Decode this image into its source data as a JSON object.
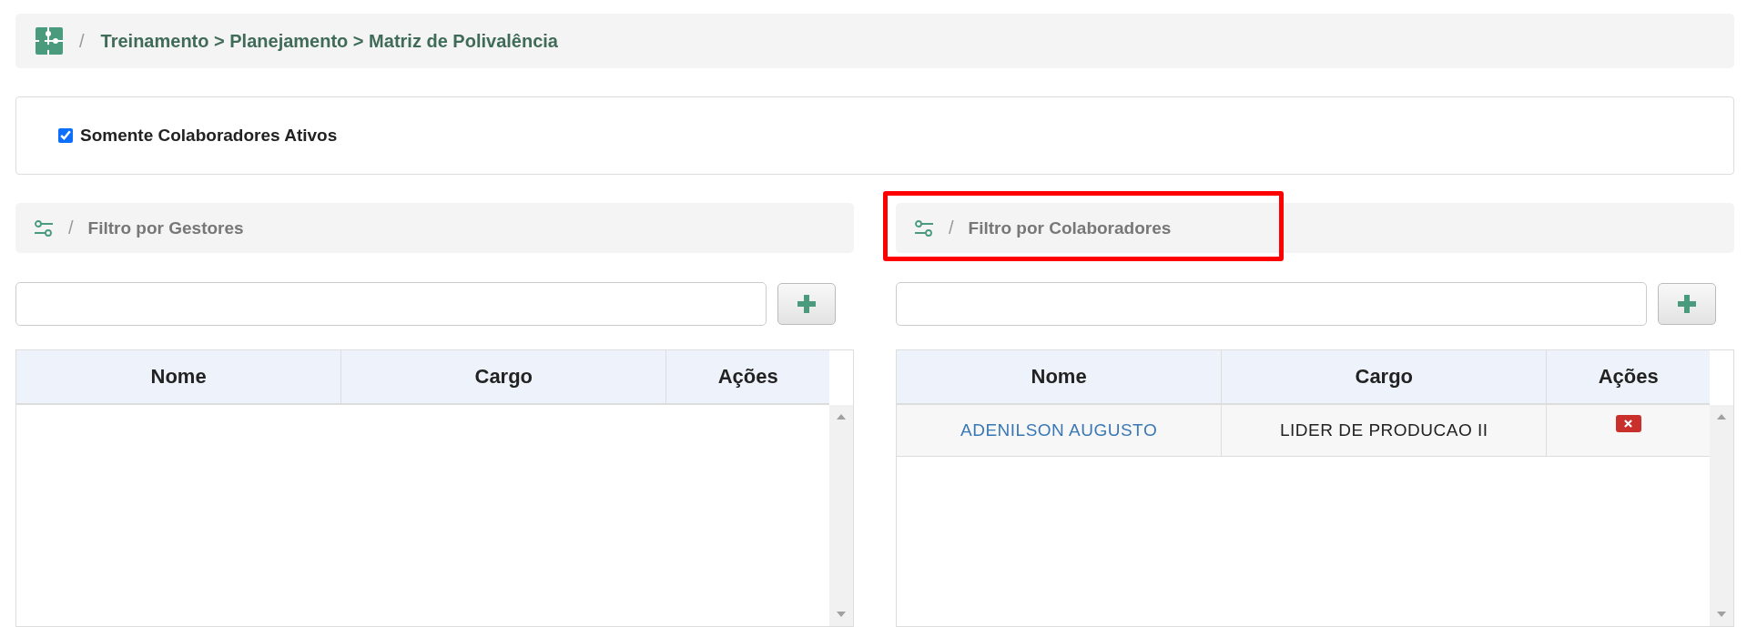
{
  "breadcrumb": {
    "separator": "/",
    "path": "Treinamento > Planejamento > Matriz de Polivalência"
  },
  "active_only": {
    "label": "Somente Colaboradores Ativos",
    "checked": true
  },
  "panels": [
    {
      "separator": "/",
      "title": "Filtro por Gestores",
      "highlighted": false,
      "columns": [
        "Nome",
        "Cargo",
        "Ações"
      ]
    },
    {
      "separator": "/",
      "title": "Filtro por Colaboradores",
      "highlighted": true,
      "columns": [
        "Nome",
        "Cargo",
        "Ações"
      ],
      "rows": [
        {
          "nome": "ADENILSON AUGUSTO",
          "cargo": "LIDER DE PRODUCAO II"
        }
      ]
    }
  ]
}
